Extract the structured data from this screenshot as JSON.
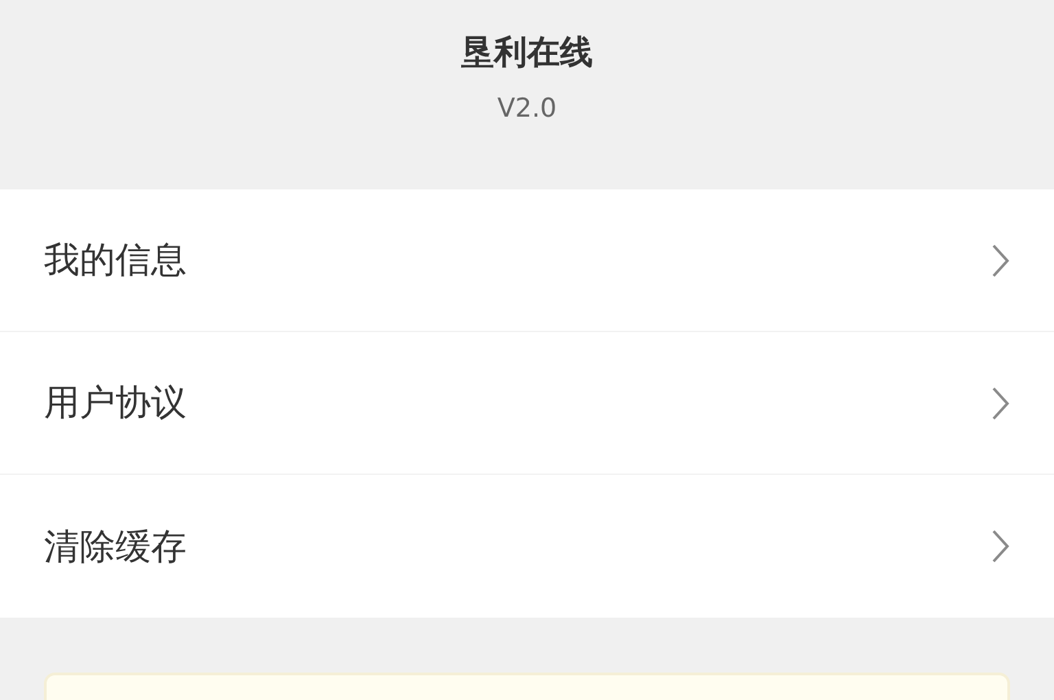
{
  "app": {
    "name": "垦利在线",
    "version": "V2.0"
  },
  "menu": [
    {
      "label": "我的信息"
    },
    {
      "label": "用户协议"
    },
    {
      "label": "清除缓存"
    }
  ]
}
